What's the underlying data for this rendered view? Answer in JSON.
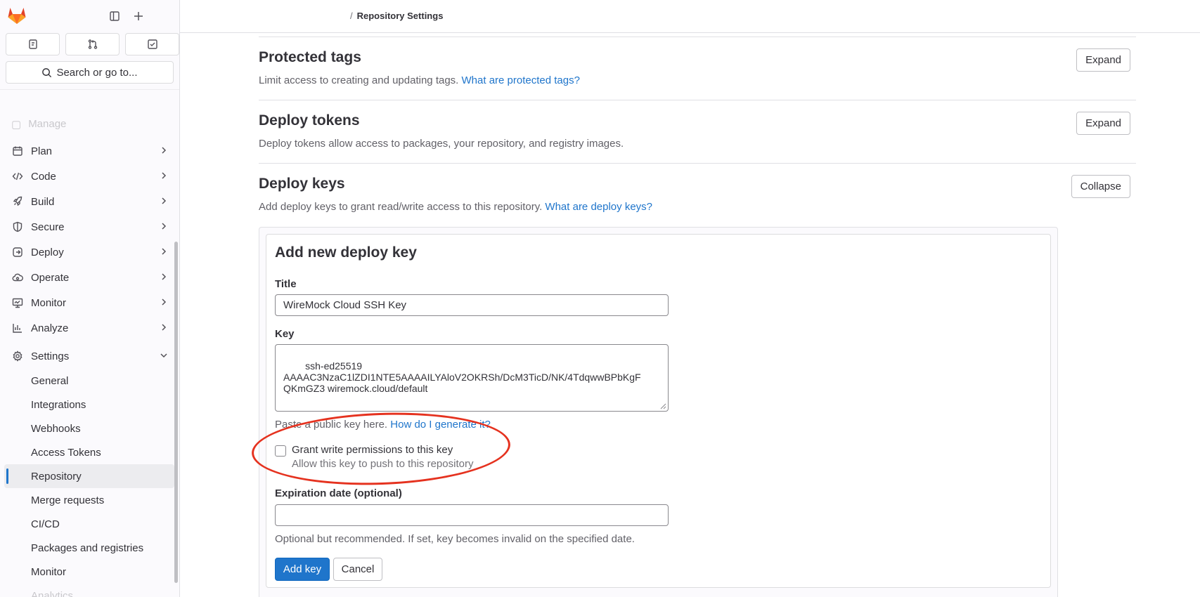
{
  "sidebar": {
    "search_label": "Search or go to...",
    "faded_item": "Manage",
    "nav": [
      {
        "label": "Plan",
        "icon": "calendar-icon"
      },
      {
        "label": "Code",
        "icon": "code-icon"
      },
      {
        "label": "Build",
        "icon": "rocket-icon"
      },
      {
        "label": "Secure",
        "icon": "shield-icon"
      },
      {
        "label": "Deploy",
        "icon": "deploy-icon"
      },
      {
        "label": "Operate",
        "icon": "cloud-icon"
      },
      {
        "label": "Monitor",
        "icon": "monitor-icon"
      },
      {
        "label": "Analyze",
        "icon": "chart-icon"
      },
      {
        "label": "Settings",
        "icon": "gear-icon"
      }
    ],
    "settings_sub": [
      "General",
      "Integrations",
      "Webhooks",
      "Access Tokens",
      "Repository",
      "Merge requests",
      "CI/CD",
      "Packages and registries",
      "Monitor",
      "Analytics"
    ],
    "active_sub": "Repository"
  },
  "topbar": {
    "separator": "/",
    "current": "Repository Settings"
  },
  "sections": {
    "protected_tags": {
      "title": "Protected tags",
      "desc": "Limit access to creating and updating tags.",
      "link": "What are protected tags?",
      "button": "Expand"
    },
    "deploy_tokens": {
      "title": "Deploy tokens",
      "desc": "Deploy tokens allow access to packages, your repository, and registry images.",
      "button": "Expand"
    },
    "deploy_keys": {
      "title": "Deploy keys",
      "desc": "Add deploy keys to grant read/write access to this repository.",
      "link": "What are deploy keys?",
      "button": "Collapse"
    }
  },
  "form": {
    "heading": "Add new deploy key",
    "title_label": "Title",
    "title_value": "WireMock Cloud SSH Key",
    "key_label": "Key",
    "key_value": "ssh-ed25519\nAAAAC3NzaC1lZDI1NTE5AAAAILYAloV2OKRSh/DcM3TicD/NK/4TdqwwBPbKgF\nQKmGZ3 wiremock.cloud/default",
    "key_help": "Paste a public key here.",
    "key_help_link": "How do I generate it?",
    "checkbox_label": "Grant write permissions to this key",
    "checkbox_help": "Allow this key to push to this repository",
    "checkbox_checked": false,
    "expiry_label": "Expiration date (optional)",
    "expiry_value": "",
    "expiry_help": "Optional but recommended. If set, key becomes invalid on the specified date.",
    "submit": "Add key",
    "cancel": "Cancel"
  },
  "colors": {
    "accent": "#1f75cb",
    "annotation": "#e5321f"
  }
}
